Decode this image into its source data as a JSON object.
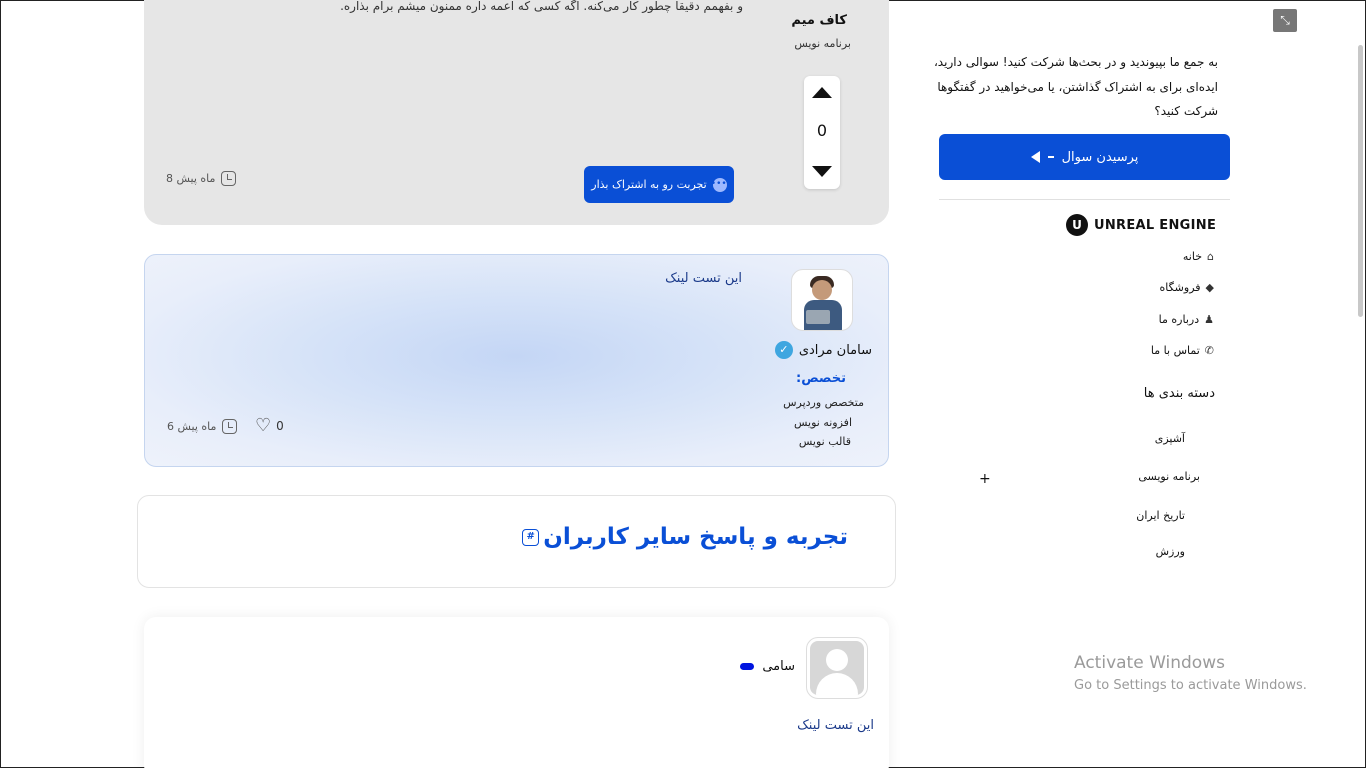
{
  "question": {
    "cut_text": "و بفهمم دقیقا چطور کار می‌کنه. اگه کسی که اعمه داره ممنون میشم برام بذاره.",
    "author": "کاف میم",
    "role": "برنامه نویس",
    "votes": "0",
    "share_label": "تجربت رو به اشتراک بذار",
    "time": "8 ماه پیش"
  },
  "answer": {
    "link": "این تست لینک",
    "author": "سامان مرادی",
    "spec_title": "تخصص:",
    "specs": [
      "متخصص وردپرس",
      "افزونه نویس",
      "قالب نویس"
    ],
    "likes": "0",
    "time": "6 ماه پیش"
  },
  "section": {
    "title": "تجربه و پاسخ سایر کاربران"
  },
  "comment": {
    "author": "سامی",
    "link": "این تست لینک"
  },
  "sidebar": {
    "intro": "به جمع ما بپیوندید و در بحث‌ها شرکت کنید! سوالی دارید، ایده‌ای برای به اشتراک گذاشتن، یا می‌خواهید در گفتگوها شرکت کنید؟",
    "ask_label": "پرسیدن سوال",
    "logo_text": "UNREAL ENGINE",
    "nav": [
      {
        "label": "خانه",
        "icon": "home-icon"
      },
      {
        "label": "فروشگاه",
        "icon": "tag-icon"
      },
      {
        "label": "درباره ما",
        "icon": "user-icon"
      },
      {
        "label": "تماس با ما",
        "icon": "phone-icon"
      }
    ],
    "categories_title": "دسته بندی ها",
    "categories": [
      "آشپزی",
      "برنامه نویسی",
      "تاریخ ایران",
      "ورزش"
    ]
  },
  "watermark": {
    "line1": "Activate Windows",
    "line2": "Go to Settings to activate Windows."
  },
  "colors": {
    "accent": "#0a4fd6",
    "verified": "#3ea6e0"
  }
}
